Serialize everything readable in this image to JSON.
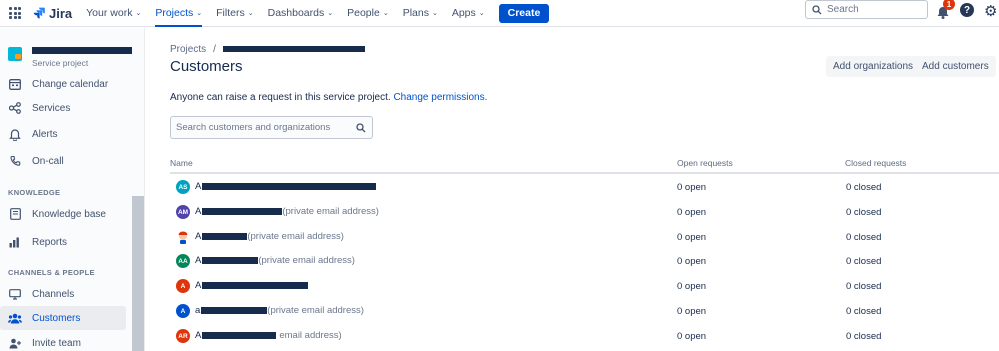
{
  "topnav": {
    "logo": "Jira",
    "items": [
      {
        "label": "Your work",
        "active": false
      },
      {
        "label": "Projects",
        "active": true
      },
      {
        "label": "Filters",
        "active": false
      },
      {
        "label": "Dashboards",
        "active": false
      },
      {
        "label": "People",
        "active": false
      },
      {
        "label": "Plans",
        "active": false
      },
      {
        "label": "Apps",
        "active": false
      }
    ],
    "create_label": "Create",
    "search_placeholder": "Search",
    "notification_count": "1",
    "help_label": "?"
  },
  "sidebar": {
    "project_type": "Service project",
    "items": [
      {
        "label": "Change calendar"
      },
      {
        "label": "Services"
      },
      {
        "label": "Alerts"
      },
      {
        "label": "On-call"
      },
      {
        "label": "Knowledge base"
      },
      {
        "label": "Reports"
      },
      {
        "label": "Channels"
      },
      {
        "label": "Customers"
      },
      {
        "label": "Invite team"
      }
    ],
    "sections": {
      "knowledge": "KNOWLEDGE",
      "channels_people": "CHANNELS & PEOPLE"
    }
  },
  "main": {
    "breadcrumb_root": "Projects",
    "breadcrumb_sep": "/",
    "title": "Customers",
    "add_orgs_label": "Add organizations",
    "add_customers_label": "Add customers",
    "description": "Anyone can raise a request in this service project.",
    "description_link": "Change permissions.",
    "search_placeholder": "Search customers and organizations",
    "columns": {
      "name": "Name",
      "open": "Open requests",
      "closed": "Closed requests"
    }
  },
  "colors": {
    "brand": "#0052cc",
    "avatar_teal": "#00a3bf",
    "avatar_purple": "#5243aa",
    "avatar_green": "#00875a",
    "avatar_orange": "#de350b",
    "avatar_blue": "#0052cc"
  },
  "customers": [
    {
      "initials": "AS",
      "color": "#00a3bf",
      "first": "A",
      "email": "",
      "open": "0 open",
      "closed": "0 closed"
    },
    {
      "initials": "AM",
      "color": "#5243aa",
      "first": "A",
      "email": "(private email address)",
      "open": "0 open",
      "closed": "0 closed"
    },
    {
      "initials": "",
      "color": "#ffffff",
      "first": "A",
      "email": "(private email address)",
      "open": "0 open",
      "closed": "0 closed"
    },
    {
      "initials": "AA",
      "color": "#00875a",
      "first": "A",
      "email": "(private email address)",
      "open": "0 open",
      "closed": "0 closed"
    },
    {
      "initials": "A",
      "color": "#de350b",
      "first": "A",
      "email": "",
      "open": "0 open",
      "closed": "0 closed"
    },
    {
      "initials": "A",
      "color": "#0052cc",
      "first": "a",
      "email": "(private email address)",
      "open": "0 open",
      "closed": "0 closed"
    },
    {
      "initials": "AR",
      "color": "#de350b",
      "first": "A",
      "email": "email address)",
      "open": "0 open",
      "closed": "0 closed"
    }
  ]
}
